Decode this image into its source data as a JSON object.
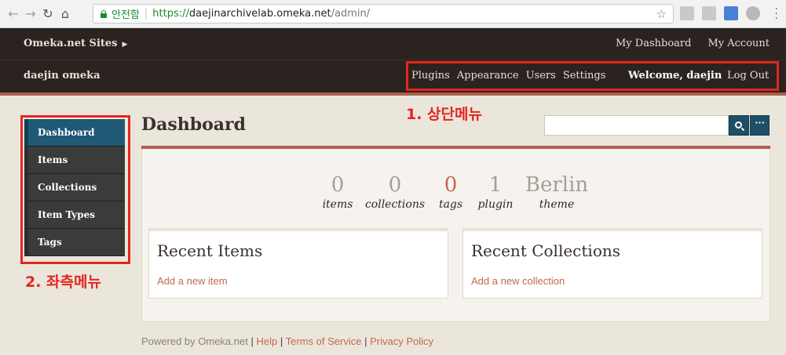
{
  "browser": {
    "secure_label": "안전함",
    "url_scheme": "https://",
    "url_host": "daejinarchivelab.omeka.net",
    "url_path": "/admin/"
  },
  "topbar": {
    "sites_label": "Omeka.net Sites",
    "my_dashboard": "My Dashboard",
    "my_account": "My Account"
  },
  "admin_bar": {
    "site_name": "daejin omeka",
    "nav": [
      "Plugins",
      "Appearance",
      "Users",
      "Settings"
    ],
    "welcome": "Welcome, daejin",
    "logout": "Log Out"
  },
  "annotations": {
    "top": "1. 상단메뉴",
    "side": "2. 좌측메뉴"
  },
  "sidebar": {
    "items": [
      "Dashboard",
      "Items",
      "Collections",
      "Item Types",
      "Tags"
    ],
    "active": "Dashboard"
  },
  "main": {
    "title": "Dashboard",
    "search_placeholder": "",
    "more_label": "···",
    "stats": [
      {
        "value": "0",
        "label": "items"
      },
      {
        "value": "0",
        "label": "collections"
      },
      {
        "value": "0",
        "label": "tags"
      },
      {
        "value": "1",
        "label": "plugin"
      },
      {
        "value": "Berlin",
        "label": "theme"
      }
    ],
    "recent_items": {
      "title": "Recent Items",
      "link": "Add a new item"
    },
    "recent_collections": {
      "title": "Recent Collections",
      "link": "Add a new collection"
    }
  },
  "footer": {
    "powered_by": "Powered by Omeka.net",
    "help": "Help",
    "terms": "Terms of Service",
    "privacy": "Privacy Policy"
  },
  "colors": {
    "top_bar": "#2a231f",
    "accent": "#b05f4a",
    "active_nav": "#1f5975",
    "annotation_red": "#e52520",
    "link": "#c0694d"
  }
}
